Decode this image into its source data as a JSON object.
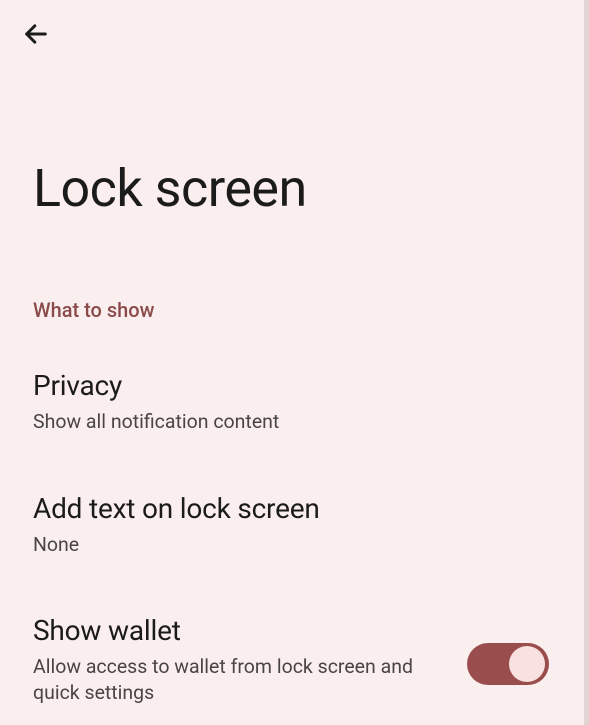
{
  "header": {
    "title": "Lock screen"
  },
  "section": {
    "label": "What to show"
  },
  "settings": {
    "privacy": {
      "title": "Privacy",
      "desc": "Show all notification content"
    },
    "add_text": {
      "title": "Add text on lock screen",
      "desc": "None"
    },
    "show_wallet": {
      "title": "Show wallet",
      "desc": "Allow access to wallet from lock screen and quick settings",
      "enabled": true
    }
  }
}
